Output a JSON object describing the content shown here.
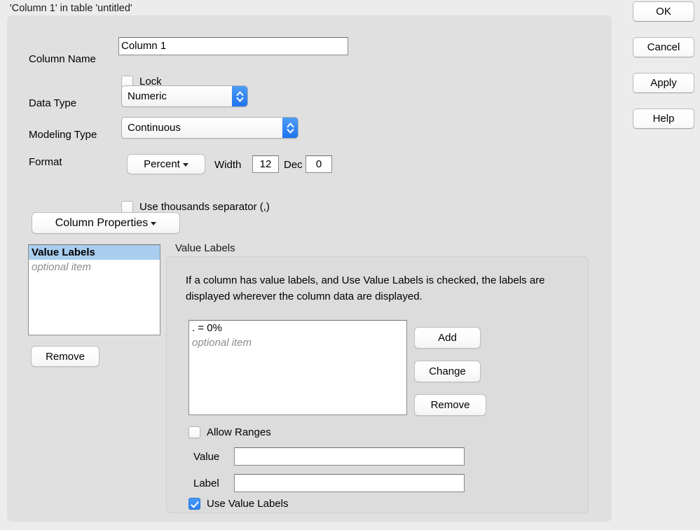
{
  "window": {
    "title": "'Column 1' in table 'untitled'"
  },
  "actions": {
    "ok": "OK",
    "cancel": "Cancel",
    "apply": "Apply",
    "help": "Help"
  },
  "form": {
    "column_name_label": "Column Name",
    "column_name_value": "Column 1",
    "lock_label": "Lock",
    "lock_checked": false,
    "data_type_label": "Data Type",
    "data_type_value": "Numeric",
    "modeling_type_label": "Modeling Type",
    "modeling_type_value": "Continuous",
    "format_label": "Format",
    "format_value": "Percent",
    "width_label": "Width",
    "width_value": "12",
    "dec_label": "Dec",
    "dec_value": "0",
    "thousands_label": "Use thousands separator (,)",
    "thousands_checked": false,
    "column_properties_label": "Column Properties"
  },
  "property_list": {
    "items": [
      {
        "label": "Value Labels",
        "selected": true,
        "placeholder": false
      },
      {
        "label": "optional item",
        "selected": false,
        "placeholder": true
      }
    ],
    "remove_label": "Remove"
  },
  "value_labels": {
    "group_title": "Value Labels",
    "description": "If a column has value labels, and Use Value Labels is checked, the labels are displayed wherever the column data are displayed.",
    "entries": [
      {
        "label": ". = 0%",
        "placeholder": false
      },
      {
        "label": "optional item",
        "placeholder": true
      }
    ],
    "add_label": "Add",
    "change_label": "Change",
    "remove_label": "Remove",
    "allow_ranges_label": "Allow Ranges",
    "allow_ranges_checked": false,
    "value_label": "Value",
    "value_value": "",
    "label_label": "Label",
    "label_value": "",
    "use_value_labels_label": "Use Value Labels",
    "use_value_labels_checked": true
  },
  "colors": {
    "window_background": "#ececec",
    "panel_background": "#e0e0e0",
    "group_background": "#dcdcdc",
    "selection_blue": "#a9cdee",
    "accent_blue": "#2d82f2"
  }
}
